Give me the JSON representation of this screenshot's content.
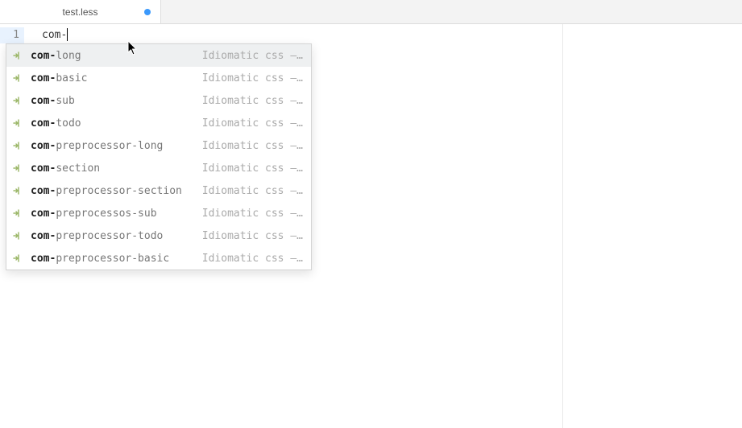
{
  "tab": {
    "filename": "test.less",
    "dirty": true
  },
  "editor": {
    "line_number": "1",
    "typed_text": "com-"
  },
  "autocomplete": {
    "match_prefix": "com-",
    "items": [
      {
        "rest": "long",
        "desc": "Idiomatic css –…",
        "selected": true
      },
      {
        "rest": "basic",
        "desc": "Idiomatic css –…",
        "selected": false
      },
      {
        "rest": "sub",
        "desc": "Idiomatic css –…",
        "selected": false
      },
      {
        "rest": "todo",
        "desc": "Idiomatic css –…",
        "selected": false
      },
      {
        "rest": "preprocessor-long",
        "desc": "Idiomatic css –…",
        "selected": false
      },
      {
        "rest": "section",
        "desc": "Idiomatic css –…",
        "selected": false
      },
      {
        "rest": "preprocessor-section",
        "desc": "Idiomatic css –…",
        "selected": false
      },
      {
        "rest": "preprocessos-sub",
        "desc": "Idiomatic css –…",
        "selected": false
      },
      {
        "rest": "preprocessor-todo",
        "desc": "Idiomatic css –…",
        "selected": false
      },
      {
        "rest": "preprocessor-basic",
        "desc": "Idiomatic css –…",
        "selected": false
      }
    ]
  }
}
